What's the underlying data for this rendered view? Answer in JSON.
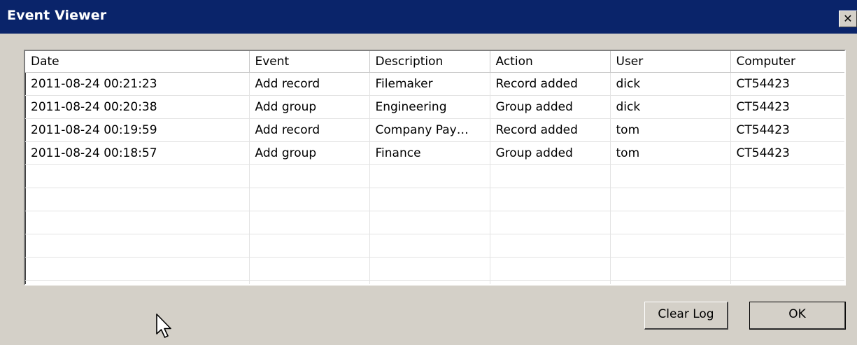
{
  "window": {
    "title": "Event Viewer",
    "close_glyph": "✕"
  },
  "table": {
    "columns": [
      "Date",
      "Event",
      "Description",
      "Action",
      "User",
      "Computer"
    ],
    "rows": [
      [
        "2011-08-24 00:21:23",
        "Add record",
        "Filemaker",
        "Record added",
        "dick",
        "CT54423"
      ],
      [
        "2011-08-24 00:20:38",
        "Add group",
        "Engineering",
        "Group added",
        "dick",
        "CT54423"
      ],
      [
        "2011-08-24 00:19:59",
        "Add record",
        "Company Pay…",
        "Record added",
        "tom",
        "CT54423"
      ],
      [
        "2011-08-24 00:18:57",
        "Add group",
        "Finance",
        "Group added",
        "tom",
        "CT54423"
      ]
    ]
  },
  "buttons": {
    "clear_log": "Clear Log",
    "ok": "OK"
  },
  "icons": {
    "cursor": "arrow-cursor-icon"
  },
  "colors": {
    "titlebar": "#0a246a",
    "dialog_face": "#d4d0c8",
    "list_background": "#ffffff"
  }
}
